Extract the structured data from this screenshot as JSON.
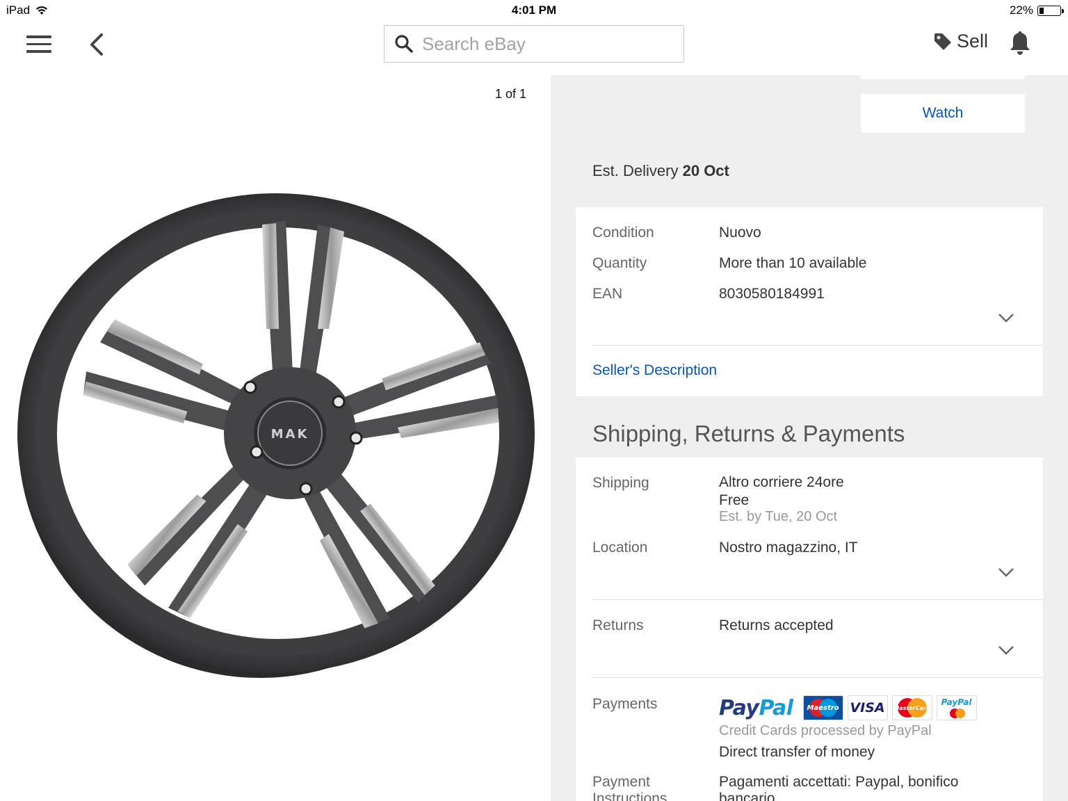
{
  "status_bar": {
    "device": "iPad",
    "time": "4:01 PM",
    "battery_percent": "22%",
    "battery_level": 0.22
  },
  "nav": {
    "search_placeholder": "Search eBay",
    "sell_label": "Sell"
  },
  "gallery": {
    "counter": "1 of 1",
    "wheel_cap_text": "MAK"
  },
  "actions": {
    "watch_label": "Watch"
  },
  "delivery": {
    "label": "Est. Delivery",
    "date": "20 Oct"
  },
  "item_specifics": {
    "rows": [
      {
        "label": "Condition",
        "value": "Nuovo"
      },
      {
        "label": "Quantity",
        "value": "More than 10 available"
      },
      {
        "label": "EAN",
        "value": "8030580184991"
      }
    ],
    "seller_description_link": "Seller's Description"
  },
  "shipping_section": {
    "title": "Shipping, Returns & Payments",
    "shipping": {
      "label": "Shipping",
      "carrier": "Altro corriere 24ore",
      "cost": "Free",
      "estimate": "Est. by Tue, 20 Oct"
    },
    "location": {
      "label": "Location",
      "value": "Nostro magazzino, IT"
    },
    "returns": {
      "label": "Returns",
      "value": "Returns accepted"
    },
    "payments": {
      "label": "Payments",
      "paypal_text_1": "Pay",
      "paypal_text_2": "Pal",
      "card_logos": [
        "Maestro",
        "VISA",
        "MasterCard",
        "PayPal"
      ],
      "credit_cards_note": "Credit Cards processed by PayPal",
      "other_method": "Direct transfer of money"
    },
    "payment_instructions": {
      "label_line1": "Payment",
      "label_line2": "Instructions",
      "value_line1": "Pagamenti accettati: Paypal, bonifico",
      "value_line2": "bancario"
    }
  },
  "colors": {
    "link_blue": "#0654ba",
    "pane_gray": "#efefef",
    "label_gray": "#666666",
    "paypal_dark": "#253b80",
    "paypal_light": "#179bd7"
  }
}
